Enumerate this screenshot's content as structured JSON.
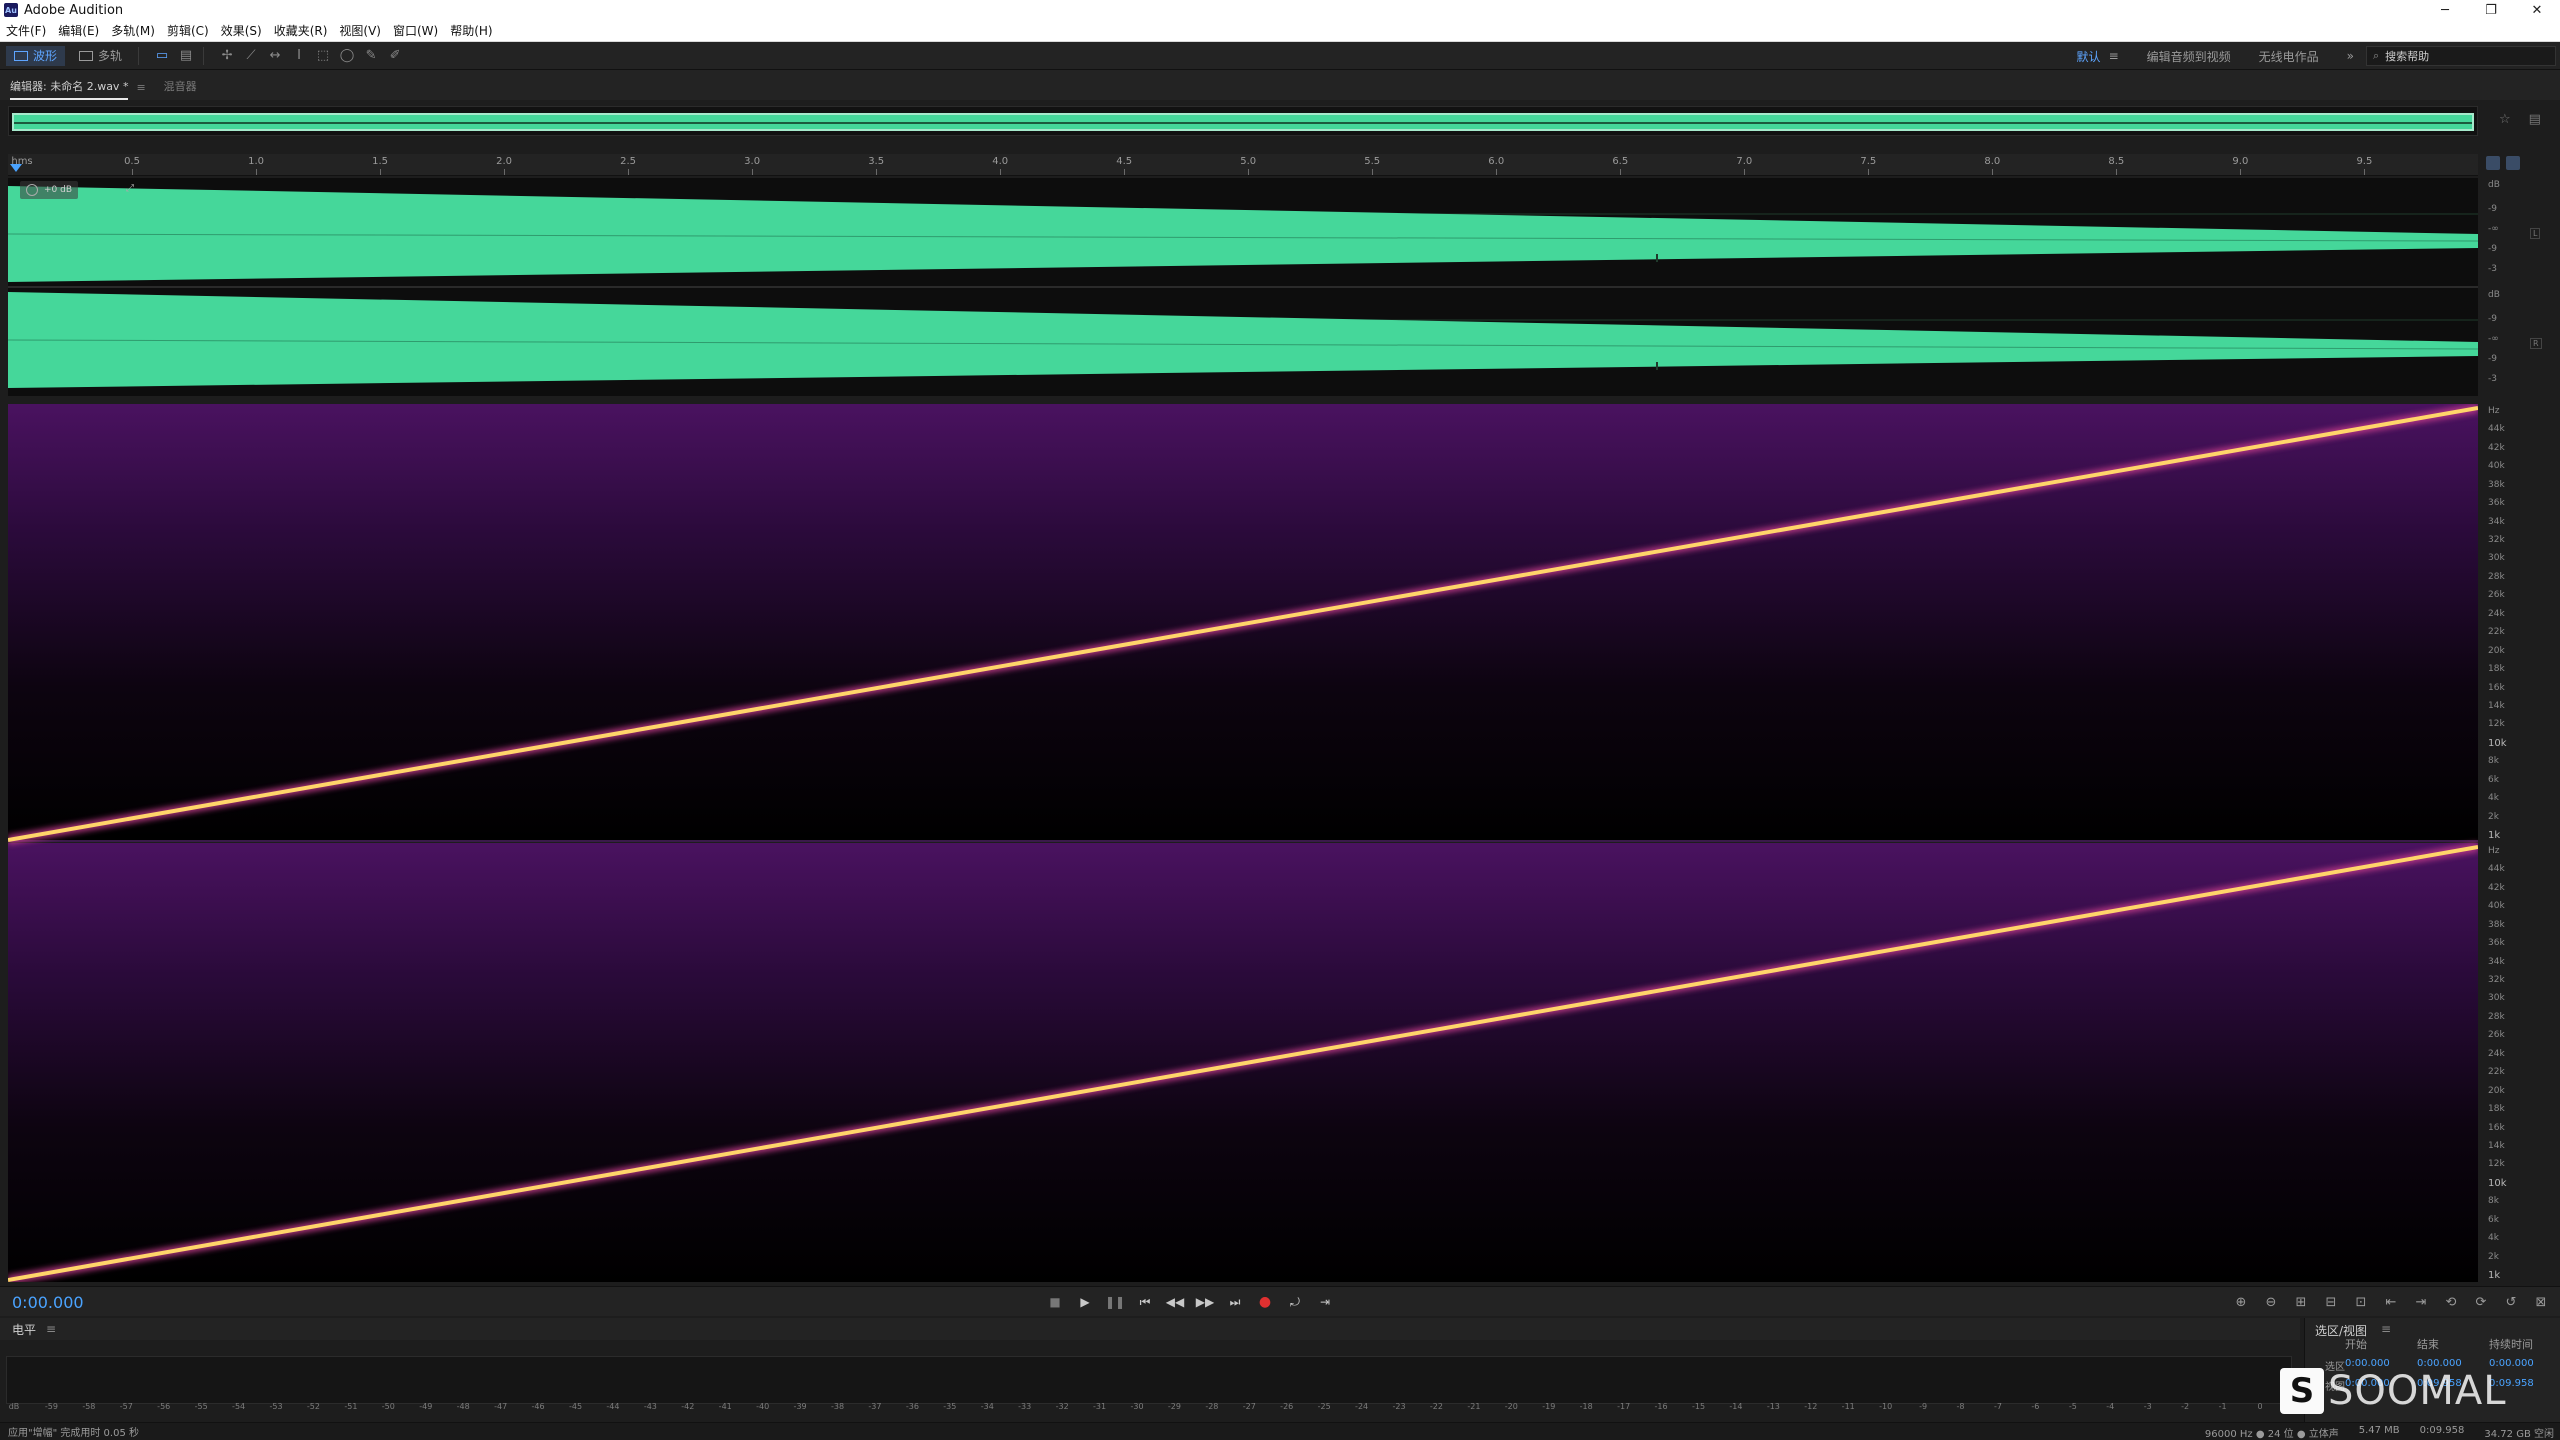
{
  "app": {
    "title": "Adobe Audition",
    "logo_text": "Au"
  },
  "window_controls": {
    "minimize": "─",
    "restore": "❐",
    "close": "✕"
  },
  "menu": [
    "文件(F)",
    "编辑(E)",
    "多轨(M)",
    "剪辑(C)",
    "效果(S)",
    "收藏夹(R)",
    "视图(V)",
    "窗口(W)",
    "帮助(H)"
  ],
  "toolbar": {
    "waveform_label": "波形",
    "multitrack_label": "多轨",
    "workspaces": [
      "默认",
      "编辑音频到视频",
      "无线电作品"
    ],
    "workspace_menu_icon": "≡",
    "more_icon": "»",
    "search_placeholder": "搜索帮助"
  },
  "tabs": {
    "editor": "编辑器: 未命名 2.wav *",
    "editor_menu": "≡",
    "mixer": "混音器"
  },
  "ruler": {
    "unit_label": "hms",
    "ticks": [
      "0.5",
      "1.0",
      "1.5",
      "2.0",
      "2.5",
      "3.0",
      "3.5",
      "4.0",
      "4.5",
      "5.0",
      "5.5",
      "6.0",
      "6.5",
      "7.0",
      "7.5",
      "8.0",
      "8.5",
      "9.0",
      "9.5"
    ]
  },
  "hud": {
    "gain": "+0 dB"
  },
  "db_scale": {
    "unit": "dB",
    "labels_ch1": [
      "dB",
      "-9",
      "-∞",
      "-9",
      "-3"
    ],
    "labels_ch2": [
      "dB",
      "-9",
      "-∞",
      "-9",
      "-3"
    ],
    "channel_left": "L",
    "channel_right": "R"
  },
  "hz_scale": {
    "labels": [
      "Hz",
      "44k",
      "42k",
      "40k",
      "38k",
      "36k",
      "34k",
      "32k",
      "30k",
      "28k",
      "26k",
      "24k",
      "22k",
      "20k",
      "18k",
      "16k",
      "14k",
      "12k",
      "10k",
      "8k",
      "6k",
      "4k",
      "2k",
      "1k"
    ]
  },
  "transport": {
    "time": "0:00.000",
    "buttons": [
      "■",
      "▶",
      "❚❚",
      "⏮",
      "◀◀",
      "▶▶",
      "⏭",
      "●",
      "⤾",
      "⇥"
    ]
  },
  "zoom": {
    "buttons": [
      "⊕",
      "⊖",
      "⊞",
      "⊟",
      "⊡",
      "⇤",
      "⇥",
      "⟲",
      "⟳",
      "↺",
      "⊠"
    ]
  },
  "levels": {
    "title": "电平",
    "menu_icon": "≡",
    "scale": [
      "dB",
      "-59",
      "-58",
      "-57",
      "-56",
      "-55",
      "-54",
      "-53",
      "-52",
      "-51",
      "-50",
      "-49",
      "-48",
      "-47",
      "-46",
      "-45",
      "-44",
      "-43",
      "-42",
      "-41",
      "-40",
      "-39",
      "-38",
      "-37",
      "-36",
      "-35",
      "-34",
      "-33",
      "-32",
      "-31",
      "-30",
      "-29",
      "-28",
      "-27",
      "-26",
      "-25",
      "-24",
      "-23",
      "-22",
      "-21",
      "-20",
      "-19",
      "-18",
      "-17",
      "-16",
      "-15",
      "-14",
      "-13",
      "-12",
      "-11",
      "-10",
      "-9",
      "-8",
      "-7",
      "-6",
      "-5",
      "-4",
      "-3",
      "-2",
      "-1",
      "0"
    ]
  },
  "selection": {
    "title": "选区/视图",
    "menu_icon": "≡",
    "headers": [
      "开始",
      "结束",
      "持续时间"
    ],
    "rows": [
      {
        "label": "选区",
        "start": "0:00.000",
        "end": "0:00.000",
        "duration": "0:00.000"
      },
      {
        "label": "视图",
        "start": "0:00.000",
        "end": "0:09.958",
        "duration": "0:09.958"
      }
    ]
  },
  "watermark": {
    "mark": "S",
    "text": "SOOMAL"
  },
  "status": {
    "left": "应用\"增幅\" 完成用时 0.05 秒",
    "right": [
      "96000 Hz ● 24 位 ● 立体声",
      "5.47 MB",
      "0:09.958",
      "34.72 GB 空闲"
    ]
  },
  "colors": {
    "waveform": "#45d79a",
    "accent": "#4aa3ff",
    "spectrum_line": "#ffd56a",
    "record": "#e03030"
  }
}
